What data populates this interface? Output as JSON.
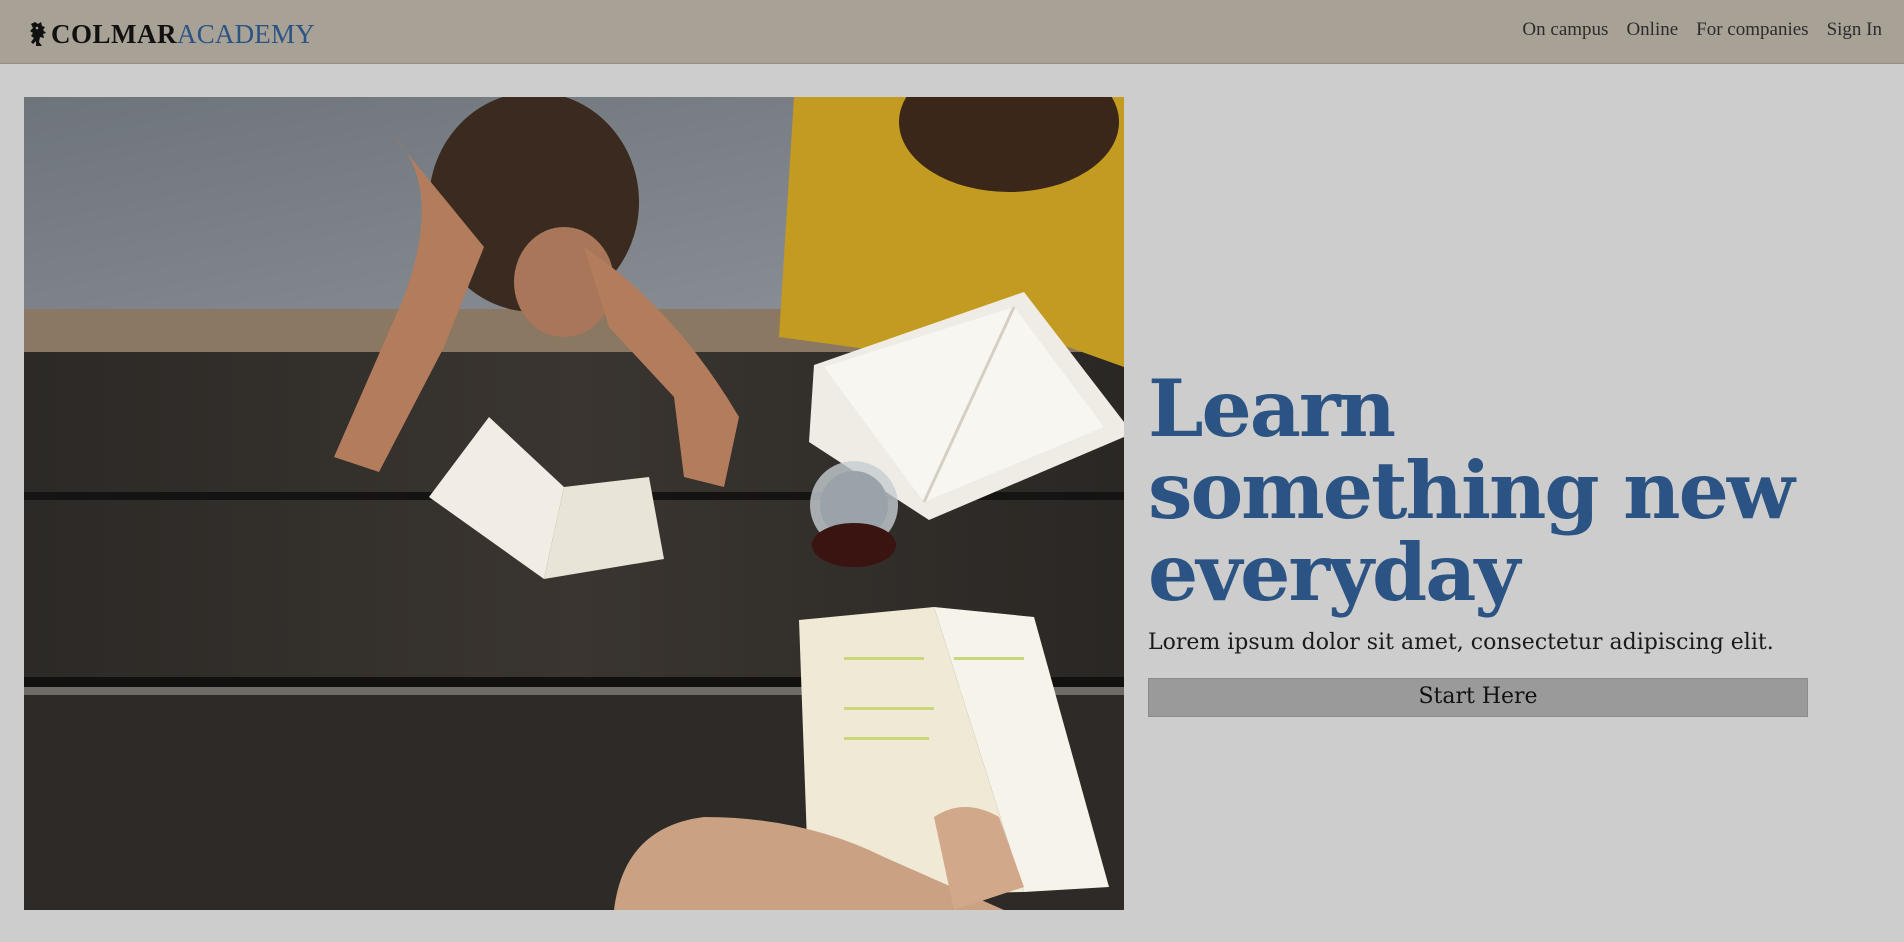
{
  "brand": {
    "name_bold": "COLMAR",
    "name_light": "ACADEMY",
    "logo_icon": "lion-crest-icon"
  },
  "nav": {
    "items": [
      {
        "label": "On campus"
      },
      {
        "label": "Online"
      },
      {
        "label": "For companies"
      },
      {
        "label": "Sign In"
      }
    ]
  },
  "hero": {
    "image_subject": "students-reading-at-wooden-table-photo",
    "headline": "Learn something new everyday",
    "subheadline": "Lorem ipsum dolor sit amet, consectetur adipiscing elit.",
    "cta_label": "Start Here"
  },
  "colors": {
    "navbar_bg": "#a8a196",
    "page_bg": "#cdcdcd",
    "accent_blue": "#2b5383",
    "button_bg": "#9a9a9a"
  }
}
